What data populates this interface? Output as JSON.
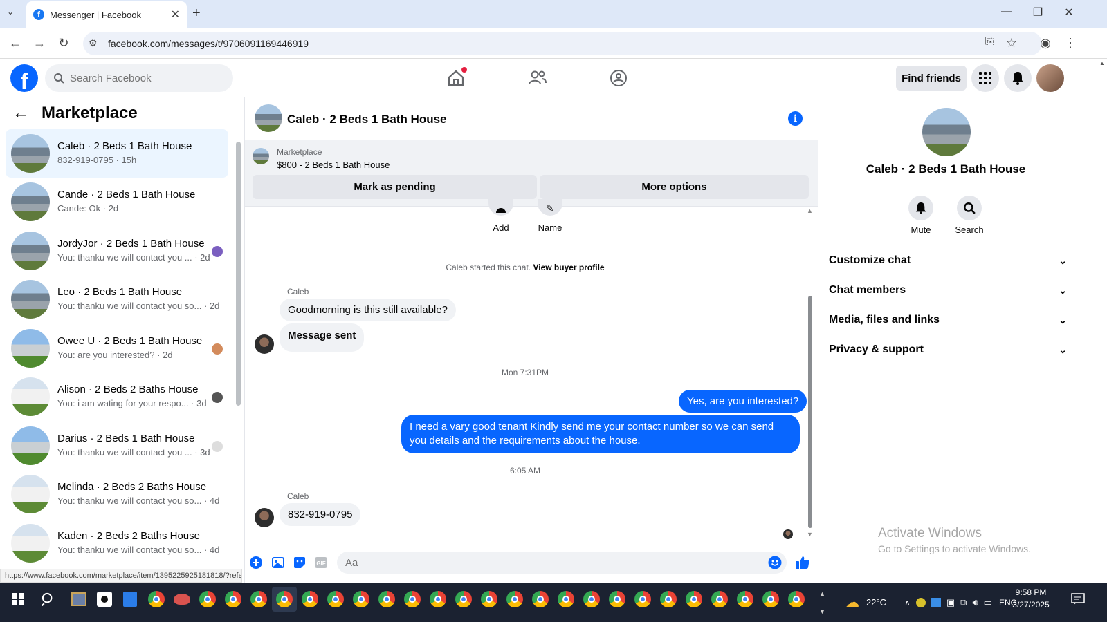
{
  "browser": {
    "tab_title": "Messenger | Facebook",
    "url": "facebook.com/messages/t/9706091169446919"
  },
  "fb_header": {
    "search_placeholder": "Search Facebook",
    "find_friends": "Find friends"
  },
  "sidebar": {
    "title": "Marketplace",
    "conversations": [
      {
        "name": "Caleb · 2 Beds 1 Bath House",
        "preview": "832-919-0795 · 15h"
      },
      {
        "name": "Cande · 2 Beds 1 Bath House",
        "preview": "Cande: Ok · 2d"
      },
      {
        "name": "JordyJor · 2 Beds 1 Bath House",
        "preview": "You: thanku we will contact you ... · 2d"
      },
      {
        "name": "Leo · 2 Beds 1 Bath House",
        "preview": "You: thanku we will contact you so... · 2d"
      },
      {
        "name": "Owee U · 2 Beds 1 Bath House",
        "preview": "You: are you interested? · 2d"
      },
      {
        "name": "Alison · 2 Beds 2 Baths House",
        "preview": "You: i am wating for your respo... · 3d"
      },
      {
        "name": "Darius · 2 Beds 1 Bath House",
        "preview": "You: thanku we will contact you ... · 3d"
      },
      {
        "name": "Melinda · 2 Beds 2 Baths House",
        "preview": "You: thanku we will contact you so... · 4d"
      },
      {
        "name": "Kaden · 2 Beds 2 Baths House",
        "preview": "You: thanku we will contact you so... · 4d"
      }
    ]
  },
  "chat": {
    "title": "Caleb · 2 Beds 1 Bath House",
    "marketplace_label": "Marketplace",
    "listing": "$800 - 2 Beds 1 Bath House",
    "mark_pending": "Mark as pending",
    "more_options": "More options",
    "action_add": "Add",
    "action_name": "Name",
    "started_text": "Caleb started this chat.",
    "view_profile": "View buyer profile",
    "sender1": "Caleb",
    "msg1": "Goodmorning is this still available?",
    "msg2": "Message sent",
    "ts1": "Mon 7:31PM",
    "out1": "Yes, are you interested?",
    "out2": "I need a vary good tenant Kindly send me your contact number so we can send you details and the requirements about the house.",
    "ts2": "6:05 AM",
    "sender2": "Caleb",
    "msg3": "832-919-0795",
    "input_placeholder": "Aa"
  },
  "details": {
    "title": "Caleb · 2 Beds 1 Bath House",
    "mute": "Mute",
    "search": "Search",
    "sections": [
      "Customize chat",
      "Chat members",
      "Media, files and links",
      "Privacy & support"
    ]
  },
  "watermark": {
    "line1": "Activate Windows",
    "line2": "Go to Settings to activate Windows."
  },
  "status_url": "https://www.facebook.com/marketplace/item/1395225925181818/?referralSurface=messenger_li...",
  "taskbar": {
    "weather": "22°C",
    "lang": "ENG",
    "time": "9:58 PM",
    "date": "3/27/2025"
  },
  "colors": {
    "brand": "#0866ff",
    "bubble_out": "#0866ff",
    "active_conv": "#ebf5ff"
  }
}
